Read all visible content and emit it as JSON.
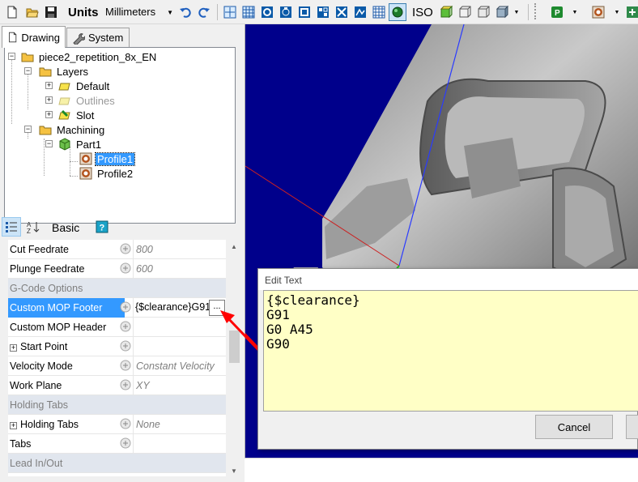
{
  "toolbar": {
    "units_label": "Units",
    "units_value": "Millimeters",
    "iso_label": "ISO"
  },
  "tabs": [
    {
      "label": "Drawing",
      "icon": "document-icon",
      "active": true
    },
    {
      "label": "System",
      "icon": "wrench-icon",
      "active": false
    }
  ],
  "tree": {
    "root": "piece2_repetition_8x_EN",
    "layers": "Layers",
    "layer_items": [
      "Default",
      "Outlines",
      "Slot"
    ],
    "machining": "Machining",
    "part": "Part1",
    "profiles": [
      "Profile1",
      "Profile2"
    ],
    "selected": "Profile1"
  },
  "props_toolbar": {
    "basic_label": "Basic",
    "sort_icon": "categorized-icon",
    "az_icon": "sort-az-icon",
    "help_icon": "help-icon"
  },
  "grid": {
    "rows": [
      {
        "type": "prop",
        "name": "Cut Feedrate",
        "value": "800"
      },
      {
        "type": "prop",
        "name": "Plunge Feedrate",
        "value": "600"
      },
      {
        "type": "cat",
        "name": "G-Code Options"
      },
      {
        "type": "prop",
        "name": "Custom MOP Footer",
        "value": "{$clearance}G91",
        "selected": true
      },
      {
        "type": "prop",
        "name": "Custom MOP Header",
        "value": ""
      },
      {
        "type": "prop",
        "name": "Start Point",
        "value": "",
        "expandable": true
      },
      {
        "type": "prop",
        "name": "Velocity Mode",
        "value": "Constant Velocity"
      },
      {
        "type": "prop",
        "name": "Work Plane",
        "value": "XY"
      },
      {
        "type": "cat",
        "name": "Holding Tabs"
      },
      {
        "type": "prop",
        "name": "Holding Tabs",
        "value": "None",
        "expandable": true
      },
      {
        "type": "prop",
        "name": "Tabs",
        "value": ""
      },
      {
        "type": "cat",
        "name": "Lead In/Out"
      }
    ],
    "ellipsis": "..."
  },
  "dialog": {
    "title": "Edit Text",
    "lines": [
      "{$clearance}",
      "G91",
      "G0 A45",
      "G90"
    ],
    "cancel": "Cancel"
  },
  "colors": {
    "viewport_bg": "#00008b",
    "editor_bg": "#ffffc6",
    "selection": "#3399ff",
    "annotation_arrow": "#ff0000"
  }
}
